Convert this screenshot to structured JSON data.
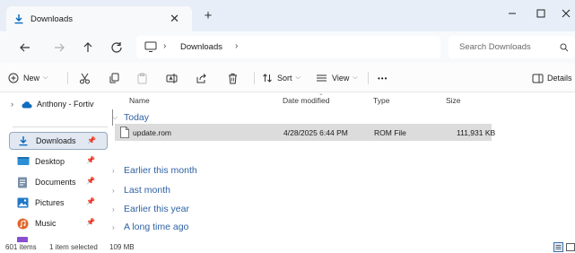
{
  "window": {
    "tab_title": "Downloads",
    "new_tab": "+",
    "tab_close": "✕"
  },
  "nav": {
    "breadcrumb": [
      "Downloads"
    ],
    "search_placeholder": "Search Downloads"
  },
  "commands": {
    "new": "New",
    "sort": "Sort",
    "view": "View",
    "more": "•••",
    "details": "Details"
  },
  "sidebar": {
    "top_item": "Anthony - Fortiv",
    "items": [
      {
        "label": "Downloads",
        "icon": "download-icon",
        "selected": true
      },
      {
        "label": "Desktop",
        "icon": "desktop-icon"
      },
      {
        "label": "Documents",
        "icon": "documents-icon"
      },
      {
        "label": "Pictures",
        "icon": "pictures-icon"
      },
      {
        "label": "Music",
        "icon": "music-icon"
      }
    ]
  },
  "columns": {
    "name": "Name",
    "date": "Date modified",
    "type": "Type",
    "size": "Size"
  },
  "groups": {
    "today": "Today",
    "collapsed": [
      "Earlier this month",
      "Last month",
      "Earlier this year",
      "A long time ago"
    ]
  },
  "files": [
    {
      "name": "update.rom",
      "date": "4/28/2025 6:44 PM",
      "type": "ROM File",
      "size": "111,931 KB",
      "selected": true
    }
  ],
  "status": {
    "items": "601 items",
    "selected": "1 item selected",
    "size": "109 MB"
  },
  "colors": {
    "accent": "#0067c0",
    "group_header": "#2f62a4",
    "titlebar": "#e8eef7"
  }
}
